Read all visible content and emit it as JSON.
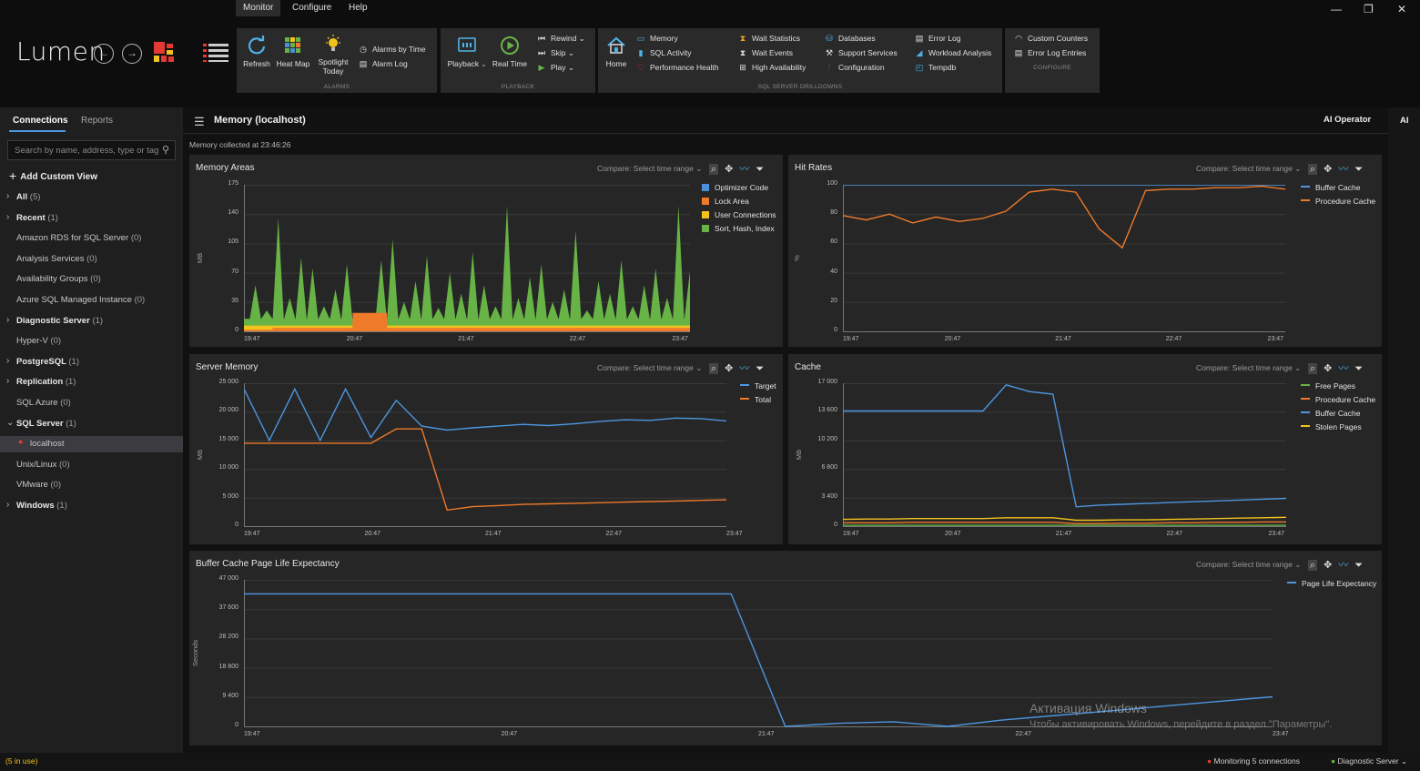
{
  "menu": {
    "tabs": [
      "Monitor",
      "Configure",
      "Help"
    ],
    "active": "Monitor"
  },
  "app": {
    "logo": "Lumen"
  },
  "ribbon": {
    "alarms": {
      "label": "ALARMS",
      "refresh": "Refresh",
      "heatmap": "Heat Map",
      "spotlight": "Spotlight Today",
      "alarms_by_time": "Alarms by Time",
      "alarm_log": "Alarm Log"
    },
    "playback": {
      "label": "PLAYBACK",
      "playback": "Playback",
      "realtime": "Real Time",
      "rewind": "Rewind",
      "skip": "Skip",
      "play": "Play"
    },
    "drilldowns": {
      "label": "SQL SERVER DRILLDOWNS",
      "home": "Home",
      "memory": "Memory",
      "sql_activity": "SQL Activity",
      "performance_health": "Performance Health",
      "wait_statistics": "Wait Statistics",
      "wait_events": "Wait Events",
      "high_availability": "High Availability",
      "databases": "Databases",
      "support_services": "Support Services",
      "configuration": "Configuration",
      "error_log": "Error Log",
      "workload_analysis": "Workload Analysis",
      "tempdb": "Tempdb"
    },
    "configure": {
      "label": "CONFIGURE",
      "custom_counters": "Custom Counters",
      "error_log_entries": "Error Log Entries"
    }
  },
  "sidebar": {
    "tabs": [
      "Connections",
      "Reports"
    ],
    "search_placeholder": "Search by name, address, type or tag",
    "add_custom_view": "Add Custom View",
    "items": [
      {
        "label": "All",
        "count": "(5)",
        "bold": true,
        "arrow": "›"
      },
      {
        "label": "Recent",
        "count": "(1)",
        "bold": true,
        "arrow": "›"
      },
      {
        "label": "Amazon RDS for SQL Server",
        "count": "(0)",
        "bold": false,
        "arrow": ""
      },
      {
        "label": "Analysis Services",
        "count": "(0)",
        "bold": false,
        "arrow": ""
      },
      {
        "label": "Availability Groups",
        "count": "(0)",
        "bold": false,
        "arrow": ""
      },
      {
        "label": "Azure SQL Managed Instance",
        "count": "(0)",
        "bold": false,
        "arrow": ""
      },
      {
        "label": "Diagnostic Server",
        "count": "(1)",
        "bold": true,
        "arrow": "›"
      },
      {
        "label": "Hyper-V",
        "count": "(0)",
        "bold": false,
        "arrow": ""
      },
      {
        "label": "PostgreSQL",
        "count": "(1)",
        "bold": true,
        "arrow": "›"
      },
      {
        "label": "Replication",
        "count": "(1)",
        "bold": true,
        "arrow": "›"
      },
      {
        "label": "SQL Azure",
        "count": "(0)",
        "bold": false,
        "arrow": ""
      },
      {
        "label": "SQL Server",
        "count": "(1)",
        "bold": true,
        "arrow": "⌄"
      },
      {
        "label": "localhost",
        "count": "",
        "bold": false,
        "arrow": "",
        "selected": true,
        "child": true
      },
      {
        "label": "Unix/Linux",
        "count": "(0)",
        "bold": false,
        "arrow": ""
      },
      {
        "label": "VMware",
        "count": "(0)",
        "bold": false,
        "arrow": ""
      },
      {
        "label": "Windows",
        "count": "(1)",
        "bold": true,
        "arrow": "›"
      }
    ]
  },
  "main": {
    "title": "Memory (localhost)",
    "ai_operator": "AI Operator",
    "ai_short": "AI",
    "collected": "Memory collected at 23:46:26",
    "compare_label": "Compare: Select time range"
  },
  "statusbar": {
    "left": "(5 in use)",
    "monitoring": "Monitoring 5 connections",
    "diagnostic": "Diagnostic Server"
  },
  "watermark": {
    "line1": "Активация Windows",
    "line2": "Чтобы активировать Windows, перейдите в раздел \"Параметры\"."
  },
  "colors": {
    "orange": "#ee7a2a",
    "green": "#67b346",
    "blue": "#4a8fd8",
    "yellow": "#f2c21d",
    "lightblue": "#4d96e0",
    "red": "#e53935",
    "grid": "#3a3a3a"
  },
  "chart_data": [
    {
      "id": "memory-areas",
      "type": "area",
      "title": "Memory Areas",
      "ylabel": "MB",
      "yticks": [
        "175",
        "140",
        "105",
        "70",
        "35",
        "0"
      ],
      "ylim": [
        0,
        175
      ],
      "xticks": [
        "19:47",
        "20:47",
        "21:47",
        "22:47",
        "23:47"
      ],
      "legend_placement": "top-right",
      "series": [
        {
          "name": "Optimizer Code",
          "color": "#4a8fd8",
          "values": [
            0
          ]
        },
        {
          "name": "Lock Area",
          "color": "#ee7a2a",
          "values": [
            2,
            2,
            2,
            4,
            4,
            4,
            4,
            4,
            4,
            4,
            22,
            22,
            22,
            4,
            4,
            4,
            4,
            4,
            4,
            4,
            4,
            4,
            4,
            4,
            4,
            4,
            4,
            4,
            4,
            4,
            4,
            4,
            4,
            4,
            4,
            4,
            4,
            4,
            4,
            4
          ]
        },
        {
          "name": "User Connections",
          "color": "#f2c21d",
          "values": [
            7,
            7,
            7,
            7,
            7,
            7,
            7,
            7,
            7,
            7,
            7,
            7,
            7,
            7,
            7,
            7,
            7,
            7,
            7,
            7,
            7,
            7,
            7,
            7,
            7,
            7,
            7,
            7,
            7,
            7,
            7,
            7,
            7,
            7,
            7,
            7,
            7,
            7,
            7,
            7
          ]
        },
        {
          "name": "Sort, Hash, Index",
          "color": "#67b346",
          "values": [
            15,
            55,
            25,
            135,
            40,
            88,
            75,
            30,
            50,
            80,
            20,
            15,
            85,
            110,
            35,
            60,
            90,
            28,
            70,
            45,
            95,
            55,
            30,
            150,
            40,
            65,
            80,
            35,
            50,
            120,
            25,
            60,
            45,
            85,
            30,
            55,
            75,
            40,
            150,
            72
          ]
        }
      ]
    },
    {
      "id": "hit-rates",
      "type": "line",
      "title": "Hit Rates",
      "ylabel": "%",
      "yticks": [
        "100",
        "80",
        "60",
        "40",
        "20",
        "0"
      ],
      "ylim": [
        0,
        100
      ],
      "xticks": [
        "19:47",
        "20:47",
        "21:47",
        "22:47",
        "23:47"
      ],
      "legend_placement": "top-right",
      "series": [
        {
          "name": "Buffer Cache",
          "color": "#4d96e0",
          "values": [
            100,
            100,
            100,
            100,
            100,
            100,
            100,
            100,
            100,
            100,
            100,
            100,
            100,
            100,
            100,
            100,
            100,
            100,
            100,
            100
          ]
        },
        {
          "name": "Procedure Cache",
          "color": "#ee7a2a",
          "values": [
            79,
            76,
            80,
            74,
            78,
            75,
            77,
            82,
            95,
            97,
            95,
            70,
            57,
            96,
            97,
            97,
            98,
            98,
            99,
            97
          ]
        }
      ]
    },
    {
      "id": "server-memory",
      "type": "line",
      "title": "Server Memory",
      "ylabel": "MB",
      "yticks": [
        "25 000",
        "20 000",
        "15 000",
        "10 000",
        "5 000",
        "0"
      ],
      "ylim": [
        0,
        25000
      ],
      "xticks": [
        "19:47",
        "20:47",
        "21:47",
        "22:47",
        "23:47"
      ],
      "legend_placement": "top-right",
      "series": [
        {
          "name": "Target",
          "color": "#4d96e0",
          "values": [
            24000,
            15000,
            24000,
            15000,
            24000,
            15500,
            22000,
            17500,
            16800,
            17200,
            17500,
            17800,
            17600,
            17900,
            18300,
            18600,
            18500,
            18900,
            18800,
            18400
          ]
        },
        {
          "name": "Total",
          "color": "#ee7a2a",
          "values": [
            14500,
            14500,
            14500,
            14500,
            14500,
            14500,
            17000,
            17000,
            2800,
            3400,
            3600,
            3800,
            3900,
            4000,
            4100,
            4200,
            4300,
            4400,
            4500,
            4600
          ]
        }
      ]
    },
    {
      "id": "cache",
      "type": "line",
      "title": "Cache",
      "ylabel": "MB",
      "yticks": [
        "17 000",
        "13 600",
        "10 200",
        "6 800",
        "3 400",
        "0"
      ],
      "ylim": [
        0,
        17000
      ],
      "xticks": [
        "19:47",
        "20:47",
        "21:47",
        "22:47",
        "23:47"
      ],
      "legend_placement": "top-right",
      "series": [
        {
          "name": "Free Pages",
          "color": "#67b346",
          "values": [
            100,
            100,
            100,
            100,
            100,
            100,
            100,
            100,
            100,
            100,
            100,
            100,
            100,
            100,
            100,
            100,
            100,
            100,
            100,
            100
          ]
        },
        {
          "name": "Procedure Cache",
          "color": "#ee7a2a",
          "values": [
            400,
            400,
            400,
            450,
            450,
            450,
            450,
            450,
            450,
            450,
            300,
            300,
            350,
            350,
            400,
            400,
            450,
            450,
            500,
            500
          ]
        },
        {
          "name": "Buffer Cache",
          "color": "#4d96e0",
          "values": [
            13700,
            13700,
            13700,
            13700,
            13700,
            13700,
            13700,
            16800,
            16000,
            15700,
            2300,
            2500,
            2600,
            2700,
            2800,
            2900,
            3000,
            3100,
            3200,
            3300
          ]
        },
        {
          "name": "Stolen Pages",
          "color": "#f2c21d",
          "values": [
            800,
            850,
            850,
            900,
            900,
            900,
            900,
            1000,
            1000,
            1000,
            700,
            700,
            750,
            750,
            800,
            850,
            900,
            950,
            1000,
            1050
          ]
        }
      ]
    },
    {
      "id": "ple",
      "type": "line",
      "title": "Buffer Cache Page Life Expectancy",
      "ylabel": "Seconds",
      "yticks": [
        "47 000",
        "37 600",
        "28 200",
        "18 800",
        "9 400",
        "0"
      ],
      "ylim": [
        0,
        47000
      ],
      "xticks": [
        "19:47",
        "20:47",
        "21:47",
        "22:47",
        "23:47"
      ],
      "legend_placement": "top-right",
      "series": [
        {
          "name": "Page Life Expectancy",
          "color": "#4d96e0",
          "values": [
            42500,
            42500,
            42500,
            42500,
            42500,
            42500,
            42500,
            42500,
            42500,
            42500,
            0,
            1000,
            1500,
            0,
            2000,
            3500,
            5000,
            6500,
            8000,
            9500
          ]
        }
      ]
    }
  ]
}
